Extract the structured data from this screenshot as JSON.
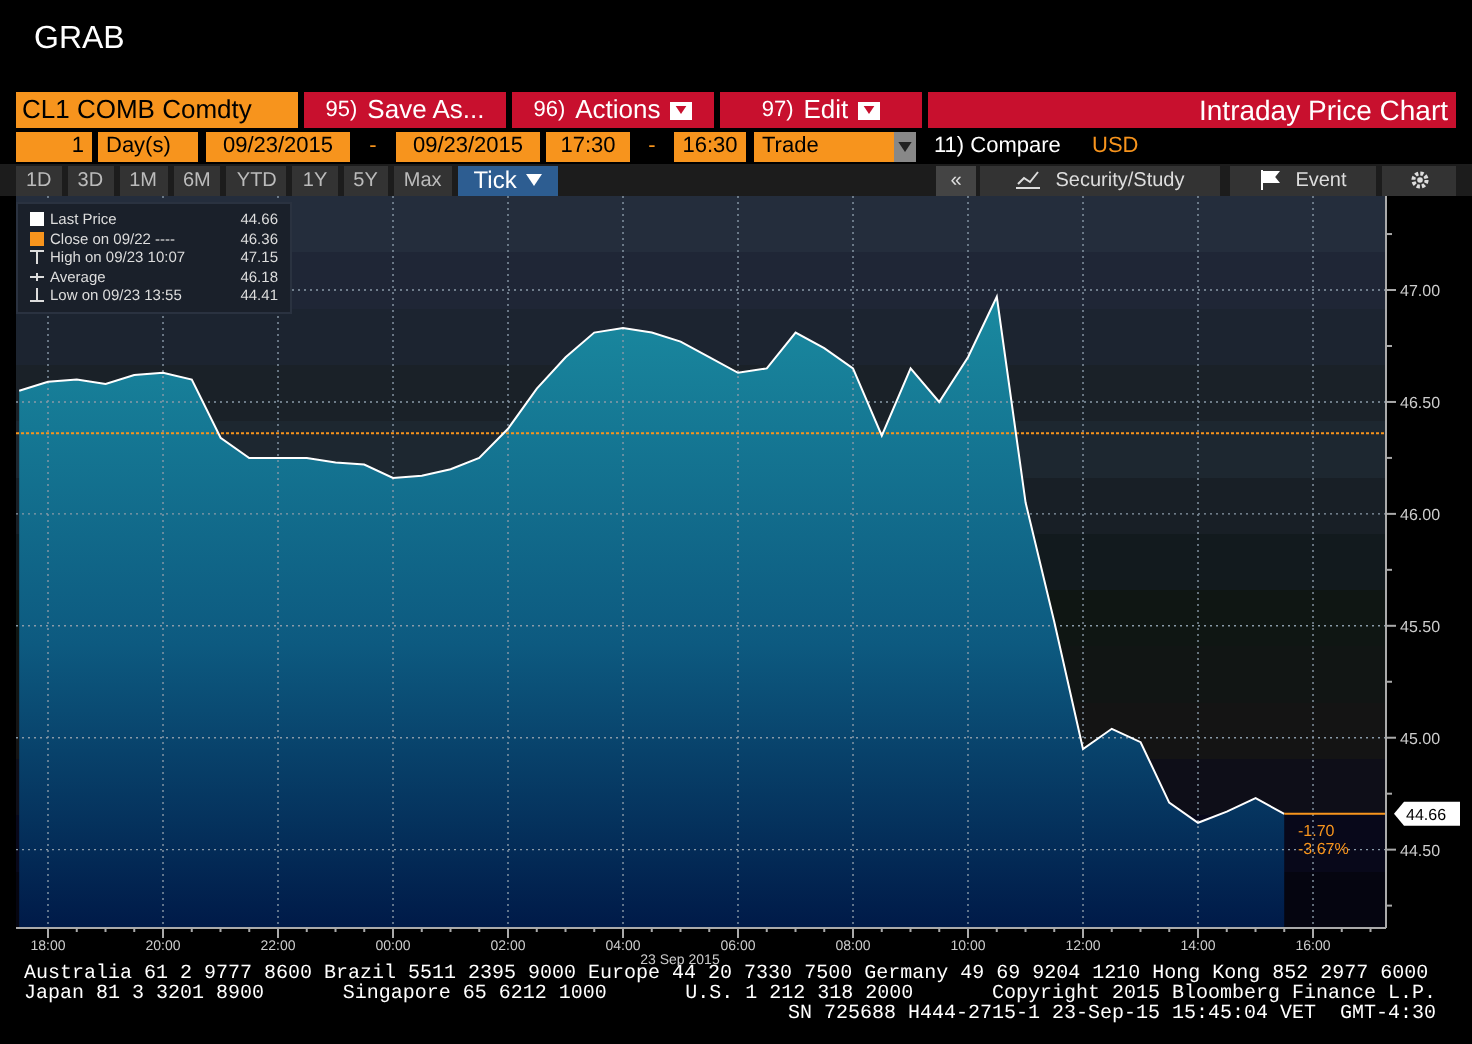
{
  "header": {
    "title": "GRAB"
  },
  "toolbar": {
    "security": "CL1 COMB Comdty",
    "buttons": [
      {
        "number": "95)",
        "label": "Save As...",
        "dropdown": false
      },
      {
        "number": "96)",
        "label": "Actions",
        "dropdown": true
      },
      {
        "number": "97)",
        "label": "Edit",
        "dropdown": true
      }
    ],
    "title": "Intraday Price Chart"
  },
  "range_bar": {
    "period_count": "1",
    "period_unit": "Day(s)",
    "start_date": "09/23/2015",
    "date_sep": "-",
    "end_date": "09/23/2015",
    "start_time": "17:30",
    "time_sep": "-",
    "end_time": "16:30",
    "field": "Trade",
    "compare": "11) Compare",
    "currency": "USD"
  },
  "periods": [
    {
      "label": "1D",
      "selected": false
    },
    {
      "label": "3D",
      "selected": false
    },
    {
      "label": "1M",
      "selected": false
    },
    {
      "label": "6M",
      "selected": false
    },
    {
      "label": "YTD",
      "selected": false
    },
    {
      "label": "1Y",
      "selected": false
    },
    {
      "label": "5Y",
      "selected": false
    },
    {
      "label": "Max",
      "selected": false
    },
    {
      "label": "Tick",
      "selected": true
    }
  ],
  "side_buttons": [
    {
      "kind": "collapse",
      "label": "«"
    },
    {
      "kind": "study",
      "label": "Security/Study"
    },
    {
      "kind": "event",
      "label": "Event"
    },
    {
      "kind": "settings"
    }
  ],
  "legend": [
    {
      "kind": "swatch",
      "color": "#ffffff",
      "label": "Last Price",
      "value": "44.66"
    },
    {
      "kind": "swatch",
      "color": "#f7941d",
      "label": "Close on 09/22 ----",
      "value": "46.36"
    },
    {
      "kind": "high",
      "label": "High on 09/23 10:07",
      "value": "47.15"
    },
    {
      "kind": "average",
      "label": "Average",
      "value": "46.18"
    },
    {
      "kind": "low",
      "label": "Low on 09/23 13:55",
      "value": "44.41"
    }
  ],
  "price_tag": "44.66",
  "change": "-1.70",
  "change_pct": "-3.67%",
  "date_label": "23 Sep 2015",
  "chart_data": {
    "type": "area",
    "categories": [
      null,
      "18:00",
      null,
      null,
      null,
      "20:00",
      null,
      null,
      null,
      "22:00",
      null,
      null,
      null,
      "00:00",
      null,
      null,
      null,
      "02:00",
      null,
      null,
      null,
      "04:00",
      null,
      null,
      null,
      "06:00",
      null,
      null,
      null,
      "08:00",
      null,
      null,
      null,
      "10:00",
      null,
      null,
      null,
      "12:00",
      null,
      null,
      null,
      "14:00",
      null,
      null,
      null,
      "16:00"
    ],
    "series": [
      {
        "color": "#ffffff",
        "values": [
          46.55,
          46.59,
          46.6,
          46.58,
          46.62,
          46.63,
          46.6,
          46.34,
          46.25,
          46.25,
          46.25,
          46.23,
          46.22,
          46.16,
          46.17,
          46.2,
          46.25,
          46.38,
          46.56,
          46.7,
          46.81,
          46.83,
          46.81,
          46.77,
          46.7,
          46.63,
          46.65,
          46.81,
          46.74,
          46.65,
          46.35,
          46.65,
          46.5,
          46.7,
          46.97,
          46.05,
          45.52,
          44.95,
          45.04,
          44.98,
          44.71,
          44.62,
          44.67,
          44.73,
          44.66,
          null
        ]
      }
    ],
    "ylim": [
      44.15,
      47.42
    ],
    "grid": true,
    "ref_lines": [
      {
        "axis": "y",
        "value": 46.36,
        "color": "#f7941d"
      }
    ],
    "yticks": [
      {
        "value": 44.5,
        "label": "44.50"
      },
      {
        "value": 45,
        "label": "45.00"
      },
      {
        "value": 45.5,
        "label": "45.50"
      },
      {
        "value": 46,
        "label": "46.00"
      },
      {
        "value": 46.5,
        "label": "46.50"
      },
      {
        "value": 47,
        "label": "47.00"
      }
    ]
  },
  "footer": {
    "line1": "Australia 61 2 9777 8600 Brazil 5511 2395 9000 Europe 44 20 7330 7500 Germany 49 69 9204 1210 Hong Kong 852 2977 6000",
    "line2": [
      "Japan 81 3 3201 8900",
      "Singapore 65 6212 1000",
      "U.S. 1 212 318 2000",
      "Copyright 2015 Bloomberg Finance L.P."
    ],
    "line3": "SN 725688 H444-2715-1 23-Sep-15 15:45:04 VET  GMT-4:30"
  }
}
